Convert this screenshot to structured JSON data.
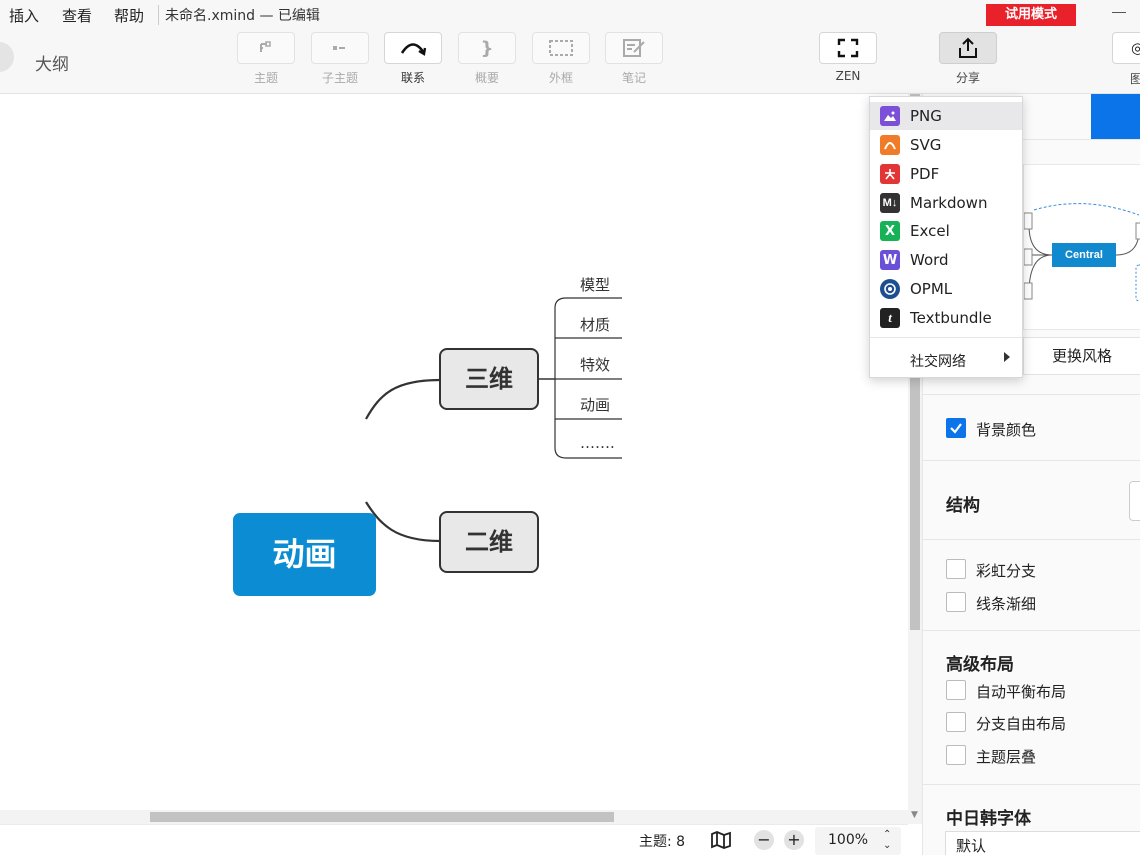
{
  "menubar": {
    "items": [
      "插入",
      "查看",
      "帮助"
    ],
    "doc_title": "未命名.xmind — 已编辑",
    "trial_badge": "试用模式"
  },
  "toolbar": {
    "outline_label": "大纲",
    "tools": [
      {
        "label": "主题",
        "icon": "topic-icon"
      },
      {
        "label": "子主题",
        "icon": "subtopic-icon"
      },
      {
        "label": "联系",
        "icon": "relationship-icon"
      },
      {
        "label": "概要",
        "icon": "summary-brace-icon"
      },
      {
        "label": "外框",
        "icon": "boundary-icon"
      },
      {
        "label": "笔记",
        "icon": "note-icon"
      }
    ],
    "zen_label": "ZEN",
    "share_label": "分享",
    "right_edge_label": "图"
  },
  "mindmap": {
    "central": "动画",
    "topics": [
      {
        "label": "三维",
        "subtopics": [
          "模型",
          "材质",
          "特效",
          "动画",
          "……."
        ]
      },
      {
        "label": "二维"
      }
    ]
  },
  "export_menu": {
    "items": [
      {
        "label": "PNG",
        "icon": "png-image-icon",
        "color": "#7b4fd8"
      },
      {
        "label": "SVG",
        "icon": "svg-icon",
        "color": "#f07b28"
      },
      {
        "label": "PDF",
        "icon": "pdf-icon",
        "color": "#e23636"
      },
      {
        "label": "Markdown",
        "icon": "markdown-icon",
        "color": "#333333"
      },
      {
        "label": "Excel",
        "icon": "excel-icon",
        "color": "#17b257"
      },
      {
        "label": "Word",
        "icon": "word-icon",
        "color": "#6a4fd8"
      },
      {
        "label": "OPML",
        "icon": "opml-icon",
        "color": "#1d4e8f"
      },
      {
        "label": "Textbundle",
        "icon": "textbundle-icon",
        "color": "#222222"
      }
    ],
    "social": "社交网络"
  },
  "panel": {
    "preview_central": "Central",
    "change_style": "更换风格",
    "background_color": "背景颜色",
    "structure_title": "结构",
    "rainbow_branch": "彩虹分支",
    "tapered_lines": "线条渐细",
    "advanced_layout_title": "高级布局",
    "auto_balance": "自动平衡布局",
    "free_branch": "分支自由布局",
    "topic_overlap": "主题层叠",
    "cjk_font_title": "中日韩字体",
    "cjk_font_value": "默认"
  },
  "status": {
    "topic_count": "主题: 8",
    "zoom": "100%"
  },
  "colors": {
    "accent": "#0a74e8",
    "central_topic": "#0b8cd3",
    "trial_red": "#e8212b"
  }
}
